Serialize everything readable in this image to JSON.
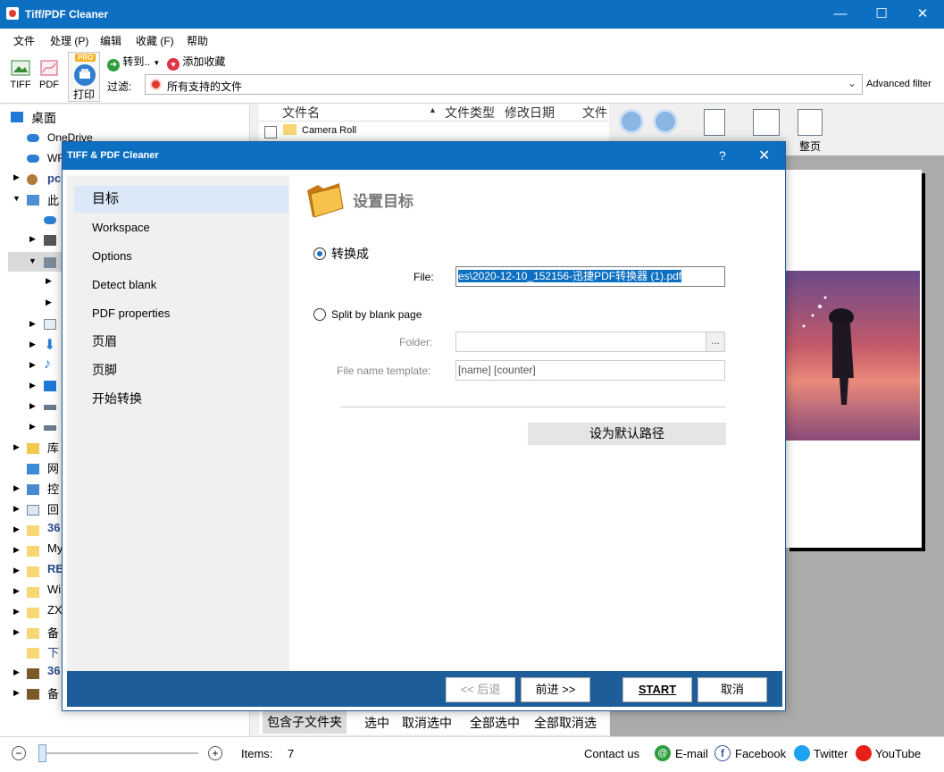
{
  "app": {
    "title": "Tiff/PDF Cleaner",
    "min_icon": "minimize-icon",
    "max_icon": "maximize-icon",
    "close_icon": "close-icon"
  },
  "menu": [
    "文件",
    "处理 (P)",
    "编辑",
    "收藏 (F)",
    "帮助"
  ],
  "toolbar": {
    "tiff_label": "TIFF",
    "pdf_label": "PDF",
    "print_label": "打印",
    "pro_badge": "PRO",
    "convert_label": "转到..",
    "favorite_label": "添加收藏",
    "filter_label": "过滤:",
    "filter_value": "所有支持的文件",
    "advanced_filter": "Advanced filter"
  },
  "tree": {
    "root": "桌面",
    "items": [
      "OneDrive",
      "WF",
      "pc",
      "此",
      "库",
      "网",
      "控",
      "回",
      "36",
      "My",
      "RE",
      "Wi",
      "ZX",
      "备",
      "下",
      "36",
      "备"
    ]
  },
  "filelist": {
    "columns": [
      "文件名",
      "文件类型",
      "修改日期",
      "文件"
    ],
    "rows": [
      {
        "name": "Camera Roll"
      }
    ]
  },
  "preview_toolbar": {
    "last_label": "整页"
  },
  "bottom_tabs": [
    "包含子文件夹",
    "选中",
    "取消选中",
    "全部选中",
    "全部取消选"
  ],
  "status": {
    "items_label": "Items:",
    "items_count": "7",
    "contact": "Contact us",
    "email": "E-mail",
    "facebook": "Facebook",
    "twitter": "Twitter",
    "youtube": "YouTube"
  },
  "dialog": {
    "title": "TIFF & PDF Cleaner",
    "help": "?",
    "nav": [
      "目标",
      "Workspace",
      "Options",
      "Detect blank",
      "PDF properties",
      "页眉",
      "页脚",
      "开始转换"
    ],
    "heading": "设置目标",
    "radio_convert": "转换成",
    "file_label": "File:",
    "file_value": "es\\2020-12-10_152156-迅捷PDF转换器 (1).pdf",
    "radio_split": "Split by blank page",
    "folder_label": "Folder:",
    "folder_value": "",
    "browse": "...",
    "template_label": "File name template:",
    "template_value": "[name] [counter]",
    "default_path_btn": "设为默认路径",
    "back_btn": "<< 后退",
    "next_btn": "前进 >>",
    "start_btn": "START",
    "cancel_btn": "取消"
  },
  "colors": {
    "titlebar": "#0d6fc1",
    "dialog_footer": "#1c5d9a",
    "nav_selected": "#dae8f7"
  }
}
